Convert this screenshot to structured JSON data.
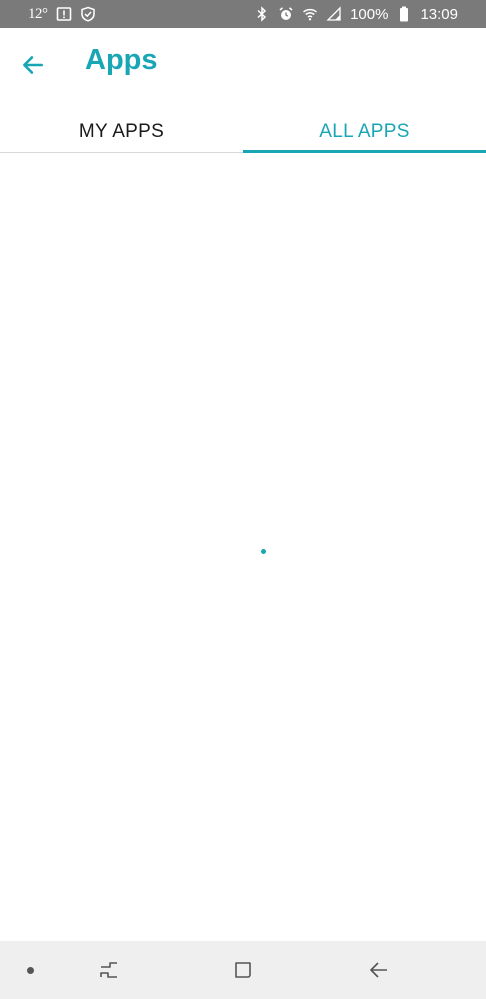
{
  "status_bar": {
    "temperature": "12°",
    "battery_percent": "100%",
    "time": "13:09",
    "icons": [
      "notification-alert-icon",
      "shield-check-icon",
      "bluetooth-icon",
      "alarm-icon",
      "wifi-icon",
      "signal-icon",
      "battery-icon"
    ]
  },
  "app_bar": {
    "title": "Apps",
    "back_icon": "arrow-left-icon"
  },
  "tabs": [
    {
      "label": "MY APPS",
      "active": false
    },
    {
      "label": "ALL APPS",
      "active": true
    }
  ],
  "content": {
    "state": "loading"
  },
  "nav_bar": {
    "icons": [
      "dot-icon",
      "recents-icon",
      "home-icon",
      "back-icon"
    ]
  },
  "colors": {
    "accent": "#19a6b4",
    "status_bar": "#7a7a7a",
    "nav_bar": "#efefef",
    "tab_inactive_text": "#1a1a1a"
  }
}
